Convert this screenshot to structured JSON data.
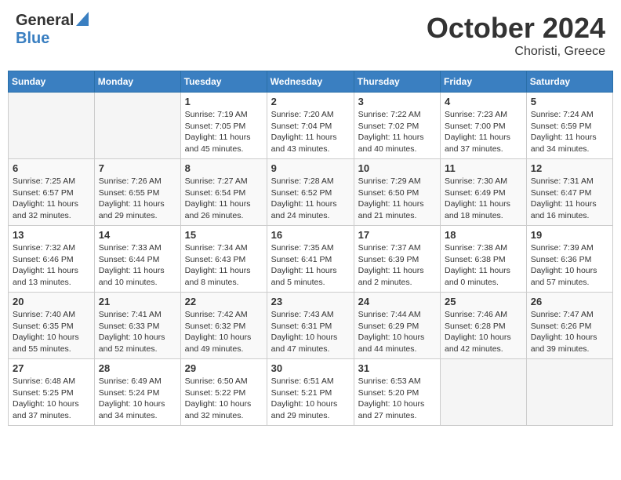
{
  "header": {
    "logo_general": "General",
    "logo_blue": "Blue",
    "month": "October 2024",
    "location": "Choristi, Greece"
  },
  "weekdays": [
    "Sunday",
    "Monday",
    "Tuesday",
    "Wednesday",
    "Thursday",
    "Friday",
    "Saturday"
  ],
  "weeks": [
    [
      {
        "day": "",
        "info": ""
      },
      {
        "day": "",
        "info": ""
      },
      {
        "day": "1",
        "info": "Sunrise: 7:19 AM\nSunset: 7:05 PM\nDaylight: 11 hours and 45 minutes."
      },
      {
        "day": "2",
        "info": "Sunrise: 7:20 AM\nSunset: 7:04 PM\nDaylight: 11 hours and 43 minutes."
      },
      {
        "day": "3",
        "info": "Sunrise: 7:22 AM\nSunset: 7:02 PM\nDaylight: 11 hours and 40 minutes."
      },
      {
        "day": "4",
        "info": "Sunrise: 7:23 AM\nSunset: 7:00 PM\nDaylight: 11 hours and 37 minutes."
      },
      {
        "day": "5",
        "info": "Sunrise: 7:24 AM\nSunset: 6:59 PM\nDaylight: 11 hours and 34 minutes."
      }
    ],
    [
      {
        "day": "6",
        "info": "Sunrise: 7:25 AM\nSunset: 6:57 PM\nDaylight: 11 hours and 32 minutes."
      },
      {
        "day": "7",
        "info": "Sunrise: 7:26 AM\nSunset: 6:55 PM\nDaylight: 11 hours and 29 minutes."
      },
      {
        "day": "8",
        "info": "Sunrise: 7:27 AM\nSunset: 6:54 PM\nDaylight: 11 hours and 26 minutes."
      },
      {
        "day": "9",
        "info": "Sunrise: 7:28 AM\nSunset: 6:52 PM\nDaylight: 11 hours and 24 minutes."
      },
      {
        "day": "10",
        "info": "Sunrise: 7:29 AM\nSunset: 6:50 PM\nDaylight: 11 hours and 21 minutes."
      },
      {
        "day": "11",
        "info": "Sunrise: 7:30 AM\nSunset: 6:49 PM\nDaylight: 11 hours and 18 minutes."
      },
      {
        "day": "12",
        "info": "Sunrise: 7:31 AM\nSunset: 6:47 PM\nDaylight: 11 hours and 16 minutes."
      }
    ],
    [
      {
        "day": "13",
        "info": "Sunrise: 7:32 AM\nSunset: 6:46 PM\nDaylight: 11 hours and 13 minutes."
      },
      {
        "day": "14",
        "info": "Sunrise: 7:33 AM\nSunset: 6:44 PM\nDaylight: 11 hours and 10 minutes."
      },
      {
        "day": "15",
        "info": "Sunrise: 7:34 AM\nSunset: 6:43 PM\nDaylight: 11 hours and 8 minutes."
      },
      {
        "day": "16",
        "info": "Sunrise: 7:35 AM\nSunset: 6:41 PM\nDaylight: 11 hours and 5 minutes."
      },
      {
        "day": "17",
        "info": "Sunrise: 7:37 AM\nSunset: 6:39 PM\nDaylight: 11 hours and 2 minutes."
      },
      {
        "day": "18",
        "info": "Sunrise: 7:38 AM\nSunset: 6:38 PM\nDaylight: 11 hours and 0 minutes."
      },
      {
        "day": "19",
        "info": "Sunrise: 7:39 AM\nSunset: 6:36 PM\nDaylight: 10 hours and 57 minutes."
      }
    ],
    [
      {
        "day": "20",
        "info": "Sunrise: 7:40 AM\nSunset: 6:35 PM\nDaylight: 10 hours and 55 minutes."
      },
      {
        "day": "21",
        "info": "Sunrise: 7:41 AM\nSunset: 6:33 PM\nDaylight: 10 hours and 52 minutes."
      },
      {
        "day": "22",
        "info": "Sunrise: 7:42 AM\nSunset: 6:32 PM\nDaylight: 10 hours and 49 minutes."
      },
      {
        "day": "23",
        "info": "Sunrise: 7:43 AM\nSunset: 6:31 PM\nDaylight: 10 hours and 47 minutes."
      },
      {
        "day": "24",
        "info": "Sunrise: 7:44 AM\nSunset: 6:29 PM\nDaylight: 10 hours and 44 minutes."
      },
      {
        "day": "25",
        "info": "Sunrise: 7:46 AM\nSunset: 6:28 PM\nDaylight: 10 hours and 42 minutes."
      },
      {
        "day": "26",
        "info": "Sunrise: 7:47 AM\nSunset: 6:26 PM\nDaylight: 10 hours and 39 minutes."
      }
    ],
    [
      {
        "day": "27",
        "info": "Sunrise: 6:48 AM\nSunset: 5:25 PM\nDaylight: 10 hours and 37 minutes."
      },
      {
        "day": "28",
        "info": "Sunrise: 6:49 AM\nSunset: 5:24 PM\nDaylight: 10 hours and 34 minutes."
      },
      {
        "day": "29",
        "info": "Sunrise: 6:50 AM\nSunset: 5:22 PM\nDaylight: 10 hours and 32 minutes."
      },
      {
        "day": "30",
        "info": "Sunrise: 6:51 AM\nSunset: 5:21 PM\nDaylight: 10 hours and 29 minutes."
      },
      {
        "day": "31",
        "info": "Sunrise: 6:53 AM\nSunset: 5:20 PM\nDaylight: 10 hours and 27 minutes."
      },
      {
        "day": "",
        "info": ""
      },
      {
        "day": "",
        "info": ""
      }
    ]
  ]
}
